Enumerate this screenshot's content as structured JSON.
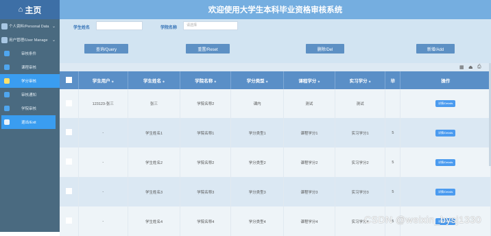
{
  "sidebar": {
    "brand": "主页",
    "groups": [
      {
        "label": "个人资料/Personal Data"
      },
      {
        "label": "用户管理/User Manage"
      }
    ],
    "items": [
      {
        "label": "审核条件"
      },
      {
        "label": "课程审核"
      },
      {
        "label": "学分审核"
      },
      {
        "label": "审核通知"
      },
      {
        "label": "学院审核"
      },
      {
        "label": "退出/Exit"
      }
    ]
  },
  "header": {
    "title": "欢迎使用大学生本科毕业资格审核系统"
  },
  "search": {
    "name_label": "学生姓名",
    "college_label": "学院名称",
    "college_placeholder": "请选择",
    "query": "查询/Query",
    "reset": "重置/Reset",
    "delete": "删除/Del",
    "add": "新增/Add"
  },
  "table": {
    "headers": [
      "学生用户",
      "学生姓名",
      "学院名称",
      "学分类型",
      "课程学分",
      "实习学分",
      "毕",
      "操作"
    ],
    "rows": [
      [
        "123123-张三",
        "张三",
        "学院名称2",
        "课内",
        "测试",
        "测试",
        "",
        "详情/Details"
      ],
      [
        "-",
        "学生姓名1",
        "学院名称1",
        "学分类型1",
        "课程学分1",
        "实习学分1",
        "5",
        "详情/Details"
      ],
      [
        "-",
        "学生姓名2",
        "学院名称2",
        "学分类型2",
        "课程学分2",
        "实习学分2",
        "5",
        "详情/Details"
      ],
      [
        "-",
        "学生姓名3",
        "学院名称3",
        "学分类型3",
        "课程学分3",
        "实习学分3",
        "5",
        "详情/Details"
      ],
      [
        "-",
        "学生姓名4",
        "学院名称4",
        "学分类型4",
        "课程学分4",
        "实习学分4",
        "5",
        "详情/Details"
      ]
    ]
  },
  "watermark": "CSDN @weixin_bysj1330"
}
